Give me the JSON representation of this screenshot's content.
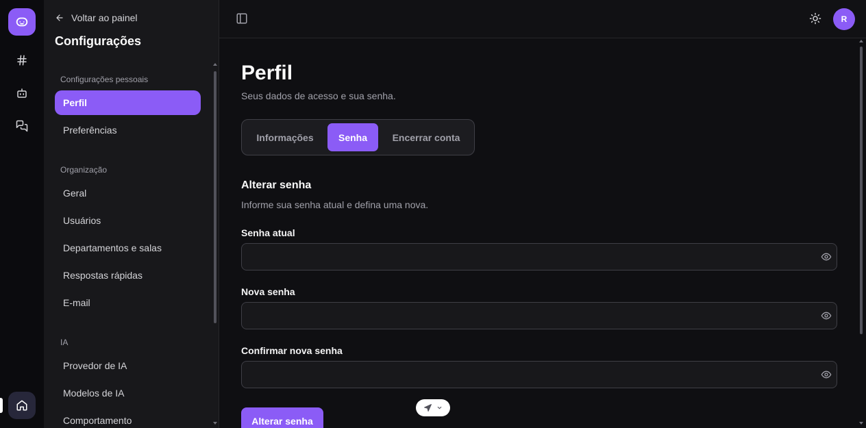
{
  "rail": {
    "logo_icon": "bot-face-icon",
    "items": [
      {
        "icon": "hash-icon"
      },
      {
        "icon": "bot-icon"
      },
      {
        "icon": "chat-icon"
      }
    ],
    "home_icon": "home-icon"
  },
  "sidebar": {
    "back_label": "Voltar ao painel",
    "title": "Configurações",
    "sections": [
      {
        "label": "Configurações pessoais",
        "items": [
          {
            "label": "Perfil",
            "active": true
          },
          {
            "label": "Preferências",
            "active": false
          }
        ]
      },
      {
        "label": "Organização",
        "items": [
          {
            "label": "Geral"
          },
          {
            "label": "Usuários"
          },
          {
            "label": "Departamentos e salas"
          },
          {
            "label": "Respostas rápidas"
          },
          {
            "label": "E-mail"
          }
        ]
      },
      {
        "label": "IA",
        "items": [
          {
            "label": "Provedor de IA"
          },
          {
            "label": "Modelos de IA"
          },
          {
            "label": "Comportamento"
          }
        ]
      }
    ]
  },
  "header": {
    "avatar_initial": "R",
    "theme_icon": "sun-icon",
    "toggle_icon": "sidebar-toggle-icon"
  },
  "main": {
    "title": "Perfil",
    "subtitle": "Seus dados de acesso e sua senha.",
    "tabs": [
      {
        "label": "Informações",
        "active": false
      },
      {
        "label": "Senha",
        "active": true
      },
      {
        "label": "Encerrar conta",
        "active": false
      }
    ],
    "section_title": "Alterar senha",
    "section_subtitle": "Informe sua senha atual e defina uma nova.",
    "fields": [
      {
        "label": "Senha atual",
        "value": ""
      },
      {
        "label": "Nova senha",
        "value": ""
      },
      {
        "label": "Confirmar nova senha",
        "value": ""
      }
    ],
    "submit_label": "Alterar senha"
  },
  "colors": {
    "accent": "#8b5cf6",
    "background": "#0f0f12",
    "sidebar": "#18181b"
  }
}
